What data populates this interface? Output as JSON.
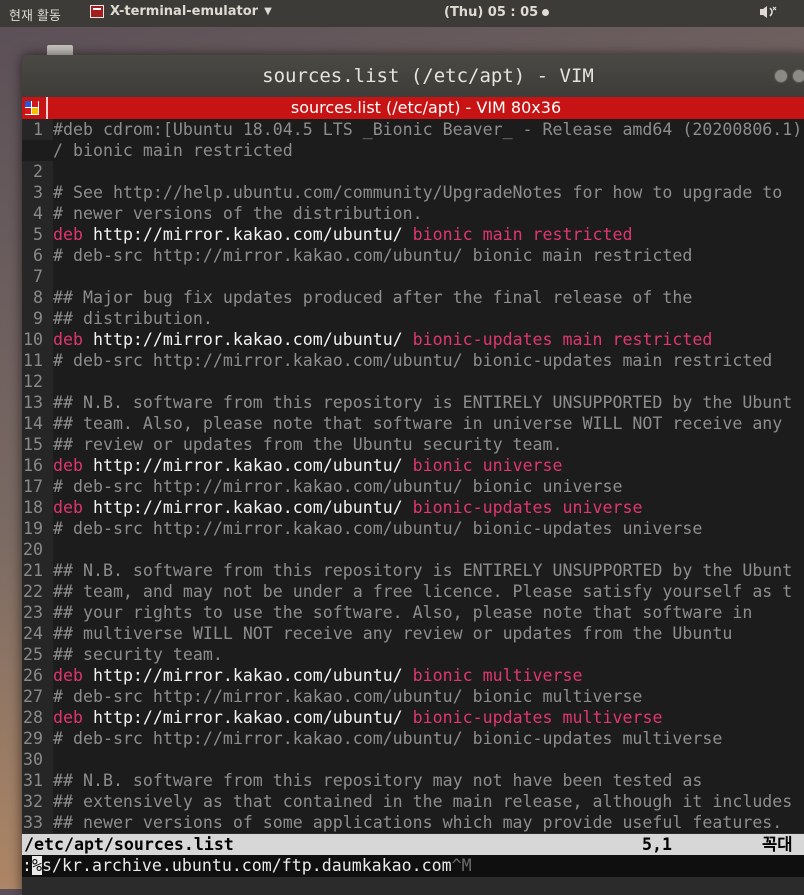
{
  "topbar": {
    "activities": "현재 활동",
    "app_name": "X-terminal-emulator",
    "clock": "(Thu) 05 : 05",
    "system_icon": "sound-icon"
  },
  "window": {
    "title": "sources.list (/etc/apt) - VIM",
    "vim_title": "sources.list (/etc/apt) - VIM 80x36"
  },
  "editor": {
    "lines": [
      {
        "n": "1",
        "parts": [
          [
            "comment",
            "#deb cdrom:[Ubuntu 18.04.5 LTS _Bionic Beaver_ - Release amd64 (20200806.1)]"
          ]
        ]
      },
      {
        "n": "",
        "parts": [
          [
            "comment",
            "/ bionic main restricted"
          ]
        ]
      },
      {
        "n": "2",
        "parts": []
      },
      {
        "n": "3",
        "parts": [
          [
            "comment",
            "# See http://help.ubuntu.com/community/UpgradeNotes for how to upgrade to"
          ]
        ]
      },
      {
        "n": "4",
        "parts": [
          [
            "comment",
            "# newer versions of the distribution."
          ]
        ]
      },
      {
        "n": "5",
        "parts": [
          [
            "kw",
            "deb"
          ],
          [
            "url",
            " http://mirror.kakao.com/ubuntu/ "
          ],
          [
            "dist",
            "bionic main restricted"
          ]
        ]
      },
      {
        "n": "6",
        "parts": [
          [
            "comment",
            "# deb-src http://mirror.kakao.com/ubuntu/ bionic main restricted"
          ]
        ]
      },
      {
        "n": "7",
        "parts": []
      },
      {
        "n": "8",
        "parts": [
          [
            "comment",
            "## Major bug fix updates produced after the final release of the"
          ]
        ]
      },
      {
        "n": "9",
        "parts": [
          [
            "comment",
            "## distribution."
          ]
        ]
      },
      {
        "n": "10",
        "parts": [
          [
            "kw",
            "deb"
          ],
          [
            "url",
            " http://mirror.kakao.com/ubuntu/ "
          ],
          [
            "dist",
            "bionic-updates main restricted"
          ]
        ]
      },
      {
        "n": "11",
        "parts": [
          [
            "comment",
            "# deb-src http://mirror.kakao.com/ubuntu/ bionic-updates main restricted"
          ]
        ]
      },
      {
        "n": "12",
        "parts": []
      },
      {
        "n": "13",
        "parts": [
          [
            "comment",
            "## N.B. software from this repository is ENTIRELY UNSUPPORTED by the Ubunt"
          ]
        ]
      },
      {
        "n": "14",
        "parts": [
          [
            "comment",
            "## team. Also, please note that software in universe WILL NOT receive any"
          ]
        ]
      },
      {
        "n": "15",
        "parts": [
          [
            "comment",
            "## review or updates from the Ubuntu security team."
          ]
        ]
      },
      {
        "n": "16",
        "parts": [
          [
            "kw",
            "deb"
          ],
          [
            "url",
            " http://mirror.kakao.com/ubuntu/ "
          ],
          [
            "dist",
            "bionic universe"
          ]
        ]
      },
      {
        "n": "17",
        "parts": [
          [
            "comment",
            "# deb-src http://mirror.kakao.com/ubuntu/ bionic universe"
          ]
        ]
      },
      {
        "n": "18",
        "parts": [
          [
            "kw",
            "deb"
          ],
          [
            "url",
            " http://mirror.kakao.com/ubuntu/ "
          ],
          [
            "dist",
            "bionic-updates universe"
          ]
        ]
      },
      {
        "n": "19",
        "parts": [
          [
            "comment",
            "# deb-src http://mirror.kakao.com/ubuntu/ bionic-updates universe"
          ]
        ]
      },
      {
        "n": "20",
        "parts": []
      },
      {
        "n": "21",
        "parts": [
          [
            "comment",
            "## N.B. software from this repository is ENTIRELY UNSUPPORTED by the Ubunt"
          ]
        ]
      },
      {
        "n": "22",
        "parts": [
          [
            "comment",
            "## team, and may not be under a free licence. Please satisfy yourself as t"
          ]
        ]
      },
      {
        "n": "23",
        "parts": [
          [
            "comment",
            "## your rights to use the software. Also, please note that software in"
          ]
        ]
      },
      {
        "n": "24",
        "parts": [
          [
            "comment",
            "## multiverse WILL NOT receive any review or updates from the Ubuntu"
          ]
        ]
      },
      {
        "n": "25",
        "parts": [
          [
            "comment",
            "## security team."
          ]
        ]
      },
      {
        "n": "26",
        "parts": [
          [
            "kw",
            "deb"
          ],
          [
            "url",
            " http://mirror.kakao.com/ubuntu/ "
          ],
          [
            "dist",
            "bionic multiverse"
          ]
        ]
      },
      {
        "n": "27",
        "parts": [
          [
            "comment",
            "# deb-src http://mirror.kakao.com/ubuntu/ bionic multiverse"
          ]
        ]
      },
      {
        "n": "28",
        "parts": [
          [
            "kw",
            "deb"
          ],
          [
            "url",
            " http://mirror.kakao.com/ubuntu/ "
          ],
          [
            "dist",
            "bionic-updates multiverse"
          ]
        ]
      },
      {
        "n": "29",
        "parts": [
          [
            "comment",
            "# deb-src http://mirror.kakao.com/ubuntu/ bionic-updates multiverse"
          ]
        ]
      },
      {
        "n": "30",
        "parts": []
      },
      {
        "n": "31",
        "parts": [
          [
            "comment",
            "## N.B. software from this repository may not have been tested as"
          ]
        ]
      },
      {
        "n": "32",
        "parts": [
          [
            "comment",
            "## extensively as that contained in the main release, although it includes"
          ]
        ]
      },
      {
        "n": "33",
        "parts": [
          [
            "comment",
            "## newer versions of some applications which may provide useful features."
          ]
        ]
      }
    ]
  },
  "status": {
    "filename": "/etc/apt/sources.list",
    "position": "5,1",
    "mode": "꼭대"
  },
  "cmdline": {
    "prefix": ":",
    "cursor_char": "%",
    "text": "s/kr.archive.ubuntu.com/ftp.daumkakao.com",
    "control": "^M"
  },
  "colors": {
    "vim_bar": "#c71313",
    "keyword": "#e0366e",
    "comment": "#8d8d8d"
  }
}
